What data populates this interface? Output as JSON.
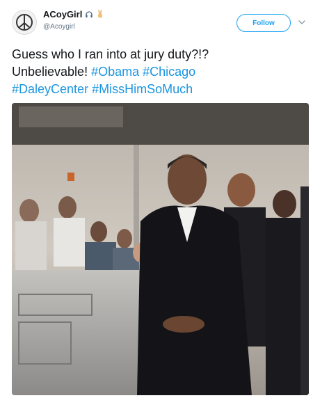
{
  "tweet": {
    "author": {
      "display_name": "ACoyGirl",
      "handle": "@Acoygirl",
      "name_emoji_icons": [
        "headphones-icon",
        "peace-hand-icon"
      ]
    },
    "follow_label": "Follow",
    "text": {
      "line1": "Guess who I ran into at jury duty?!?",
      "line2_prefix": "Unbelievable! ",
      "hashtags_line2": [
        "#Obama",
        "#Chicago"
      ],
      "hashtags_line3": [
        "#DaleyCenter",
        "#MissHimSoMuch"
      ]
    },
    "photo": {
      "description_icon": "photo-image"
    }
  },
  "colors": {
    "link": "#1b95e0",
    "follow_border": "#1da1f2",
    "text": "#14171a",
    "muted": "#657786"
  }
}
